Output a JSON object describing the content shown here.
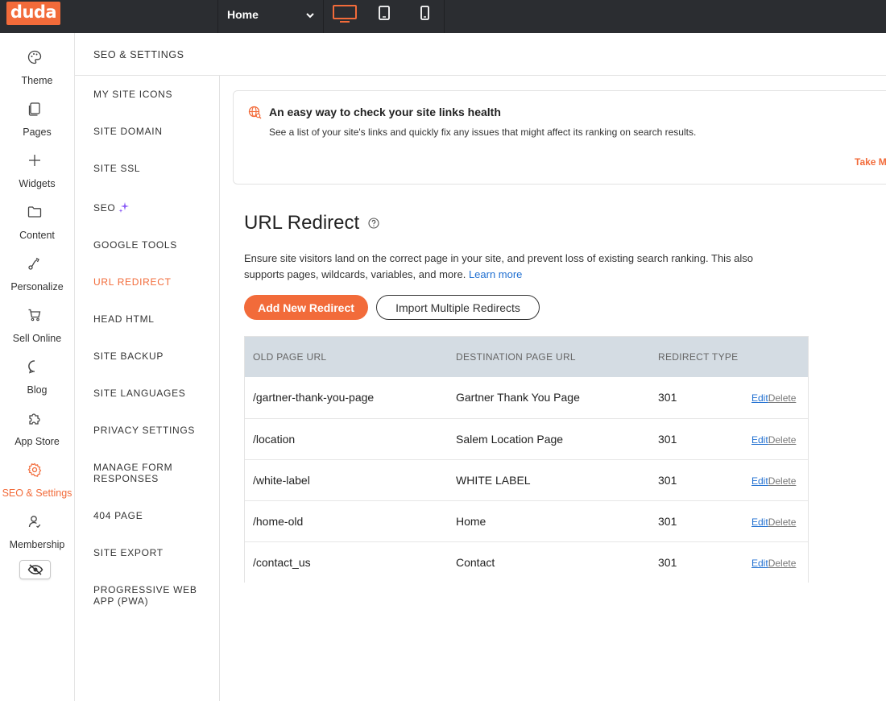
{
  "topbar": {
    "logo": "duda",
    "page_select": "Home",
    "devices": [
      "desktop-icon",
      "tablet-icon",
      "mobile-icon"
    ],
    "accent": "#f26b3a"
  },
  "rail": {
    "items": [
      {
        "label": "Theme",
        "icon": "palette-icon"
      },
      {
        "label": "Pages",
        "icon": "pages-icon"
      },
      {
        "label": "Widgets",
        "icon": "plus-icon"
      },
      {
        "label": "Content",
        "icon": "folder-icon"
      },
      {
        "label": "Personalize",
        "icon": "personalize-icon"
      },
      {
        "label": "Sell Online",
        "icon": "cart-icon"
      },
      {
        "label": "Blog",
        "icon": "chat-bubble-icon"
      },
      {
        "label": "App Store",
        "icon": "puzzle-icon"
      },
      {
        "label": "SEO & Settings",
        "icon": "gear-icon"
      },
      {
        "label": "Membership",
        "icon": "user-icon"
      }
    ],
    "active": "SEO & Settings"
  },
  "settings_nav": {
    "header": "SEO & SETTINGS",
    "items": [
      "MY SITE ICONS",
      "SITE DOMAIN",
      "SITE SSL",
      "SEO",
      "GOOGLE TOOLS",
      "URL REDIRECT",
      "HEAD HTML",
      "SITE BACKUP",
      "SITE LANGUAGES",
      "PRIVACY SETTINGS",
      "MANAGE FORM RESPONSES",
      "404 PAGE",
      "SITE EXPORT",
      "PROGRESSIVE WEB APP (PWA)"
    ],
    "active": "URL REDIRECT"
  },
  "banner": {
    "title": "An easy way to check your site links health",
    "description": "See a list of your site's links and quickly fix any issues that might affect its ranking on search results.",
    "link": "Take M"
  },
  "main": {
    "title": "URL Redirect",
    "description": "Ensure site visitors land on the correct page in your site, and prevent loss of existing search ranking. This also supports pages, wildcards, variables, and more.",
    "learn_more": "Learn more",
    "add_button": "Add New Redirect",
    "import_button": "Import Multiple Redirects"
  },
  "table": {
    "headers": [
      "OLD PAGE URL",
      "DESTINATION PAGE URL",
      "REDIRECT TYPE"
    ],
    "edit_label": "Edit",
    "delete_label": "Delete",
    "rows": [
      {
        "old": "/gartner-thank-you-page",
        "dest": "Gartner Thank You Page",
        "type": "301"
      },
      {
        "old": "/location",
        "dest": "Salem Location Page",
        "type": "301"
      },
      {
        "old": "/white-label",
        "dest": "WHITE LABEL",
        "type": "301"
      },
      {
        "old": "/home-old",
        "dest": "Home",
        "type": "301"
      },
      {
        "old": "/contact_us",
        "dest": "Contact",
        "type": "301"
      }
    ]
  }
}
